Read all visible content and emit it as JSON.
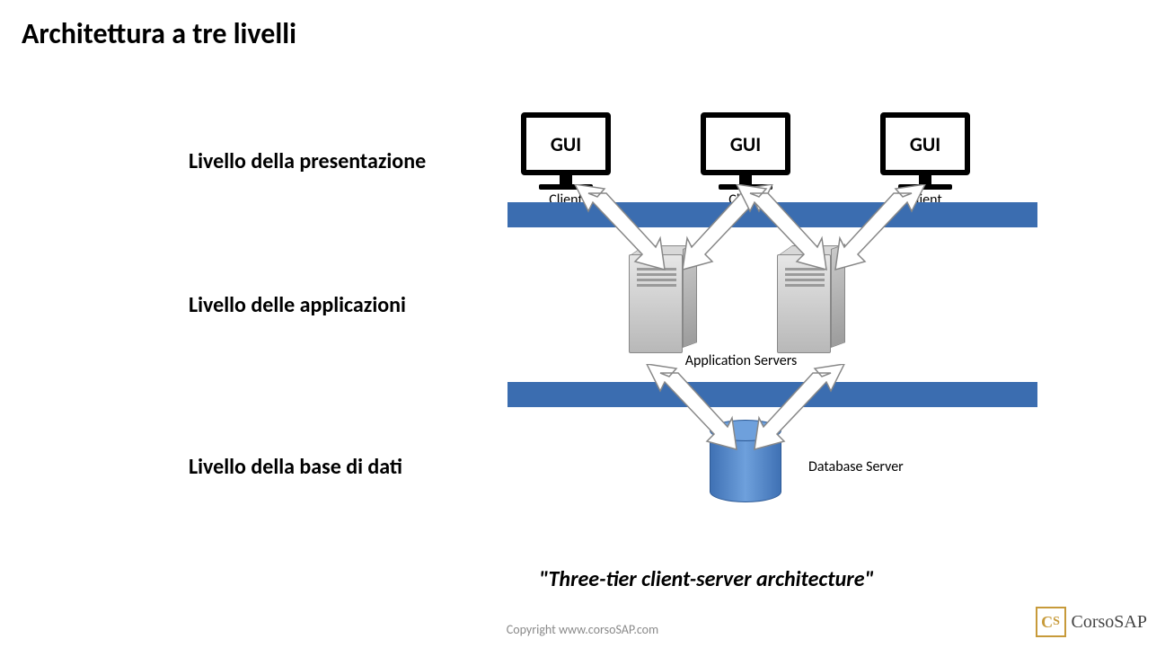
{
  "title": "Architettura a tre livelli",
  "tiers": {
    "presentation": "Livello della presentazione",
    "application": "Livello delle applicazioni",
    "database": "Livello della base di dati"
  },
  "clients": [
    {
      "label": "GUI",
      "caption": "Client"
    },
    {
      "label": "GUI",
      "caption": "Client"
    },
    {
      "label": "GUI",
      "caption": "Client"
    }
  ],
  "appServersLabel": "Application Servers",
  "dbLabel": "Database Server",
  "captionEn": "\"Three-tier client-server architecture\"",
  "copyright": "Copyright www.corsoSAP.com",
  "logo": {
    "mark": "Cs",
    "text": "CorsoSAP"
  },
  "colors": {
    "bar": "#3b6db0",
    "db": "#6ea0dc"
  }
}
